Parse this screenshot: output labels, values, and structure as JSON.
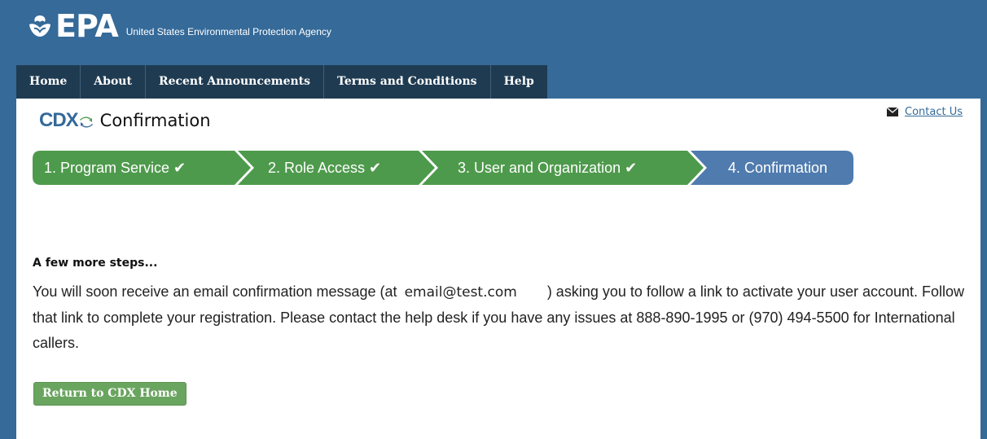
{
  "header": {
    "logo_text": "EPA",
    "agency_name": "United States Environmental Protection Agency",
    "colors": {
      "header_bg": "#356a99",
      "nav_bg": "#1f3b52"
    }
  },
  "nav": {
    "items": [
      {
        "label": "Home"
      },
      {
        "label": "About"
      },
      {
        "label": "Recent Announcements"
      },
      {
        "label": "Terms and Conditions"
      },
      {
        "label": "Help"
      }
    ]
  },
  "page": {
    "cdx_logo": "CDX",
    "title": "Confirmation",
    "contact_label": "Contact Us"
  },
  "steps": [
    {
      "label": "1. Program Service ✔",
      "state": "complete"
    },
    {
      "label": "2. Role Access ✔",
      "state": "complete"
    },
    {
      "label": "3. User and Organization ✔",
      "state": "complete"
    },
    {
      "label": "4. Confirmation",
      "state": "current"
    }
  ],
  "step_colors": {
    "complete": "#4e9a4c",
    "current": "#4f7bae"
  },
  "message": {
    "heading": "A few more steps...",
    "text_before": "You will soon receive an email confirmation message (at",
    "email": "email@test.com",
    "text_after": ") asking you to follow a link to activate your user account. Follow that link to complete your registration. Please contact the help desk if you have any issues at 888-890-1995 or (970) 494-5500 for International callers."
  },
  "actions": {
    "return_label": "Return to CDX Home"
  }
}
